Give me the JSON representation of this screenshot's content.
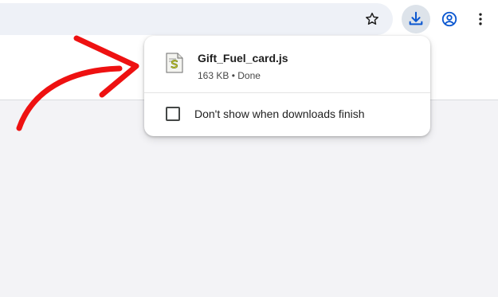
{
  "toolbar": {
    "omnibox_value": "",
    "icons": [
      "star-icon",
      "download-icon",
      "profile-icon",
      "more-vert-icon"
    ]
  },
  "downloads_bubble": {
    "item": {
      "file_name": "Gift_Fuel_card.js",
      "status": "163 KB • Done",
      "icon": "script-file-icon"
    },
    "checkbox_label": "Don't show when downloads finish",
    "checkbox_checked": false
  },
  "annotation": {
    "arrow_color": "#ee1111"
  },
  "colors": {
    "download_button_bg": "#dde3ea",
    "download_icon": "#0b57d0",
    "profile_icon": "#0b57d0",
    "page_bg": "#f3f3f6"
  }
}
